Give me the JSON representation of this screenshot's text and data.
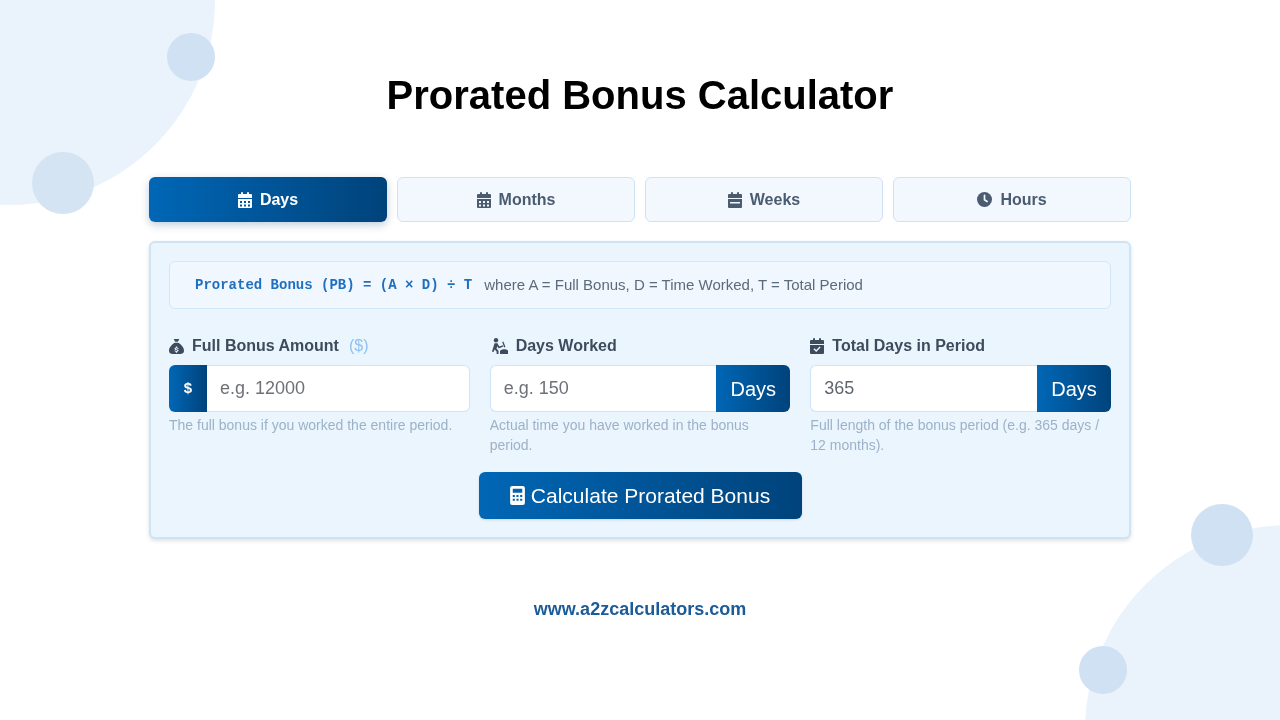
{
  "title": "Prorated Bonus Calculator",
  "tabs": [
    {
      "label": "Days",
      "selected": true
    },
    {
      "label": "Months",
      "selected": false
    },
    {
      "label": "Weeks",
      "selected": false
    },
    {
      "label": "Hours",
      "selected": false
    }
  ],
  "formula": {
    "expression": "Prorated Bonus (PB) = (A × D) ÷ T",
    "legend": "where A = Full Bonus, D = Time Worked, T = Total Period"
  },
  "fields": [
    {
      "label": "Full Bonus Amount",
      "unit_hint": "($)",
      "prefix": "$",
      "placeholder": "e.g. 12000",
      "help": "The full bonus if you worked the entire period."
    },
    {
      "label": "Days Worked",
      "placeholder": "e.g. 150",
      "suffix": "Days",
      "help": "Actual time you have worked in the bonus period."
    },
    {
      "label": "Total Days in Period",
      "value": "365",
      "suffix": "Days",
      "help": "Full length of the bonus period (e.g. 365 days / 12 months)."
    }
  ],
  "calculate_button": {
    "label": "Calculate Prorated Bonus"
  },
  "footer": {
    "website": "www.a2zcalculators.com"
  }
}
